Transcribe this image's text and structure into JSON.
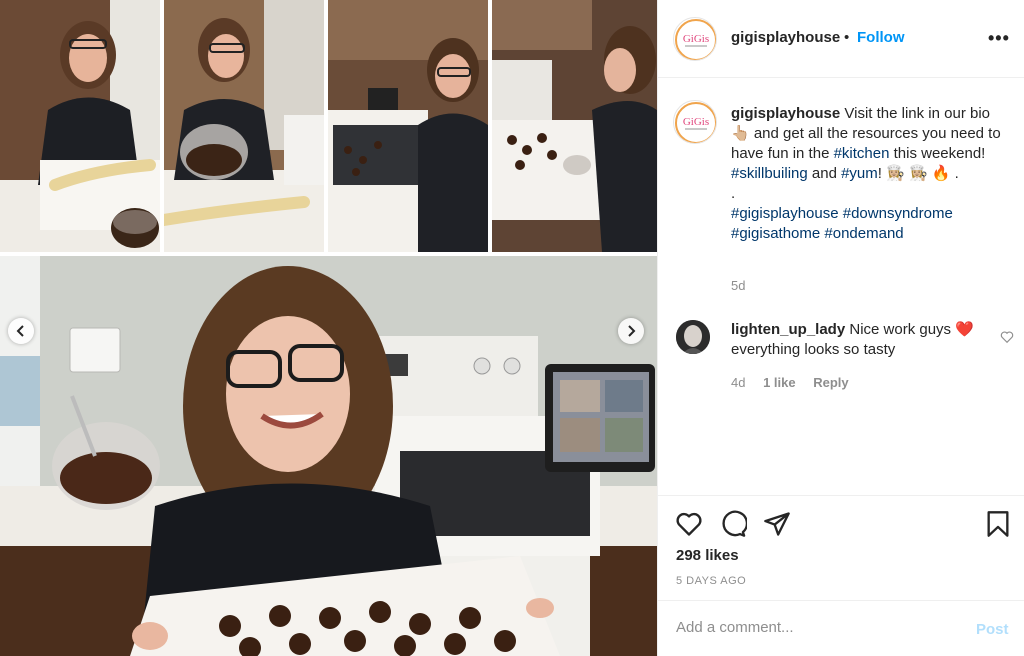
{
  "post": {
    "username": "gigisplayhouse",
    "separator": "•",
    "follow_label": "Follow",
    "more_label": "•••",
    "caption": {
      "part1": "Visit the link in our bio 👆🏼 and get all the resources you need to have fun in the ",
      "tag_kitchen": "#kitchen",
      "part2": " this weekend! ",
      "tag_skill": "#skillbuiling",
      "part3": " and ",
      "tag_yum": "#yum",
      "part4": "! 👩🏼‍🍳 👩🏼‍🍳 🔥 .",
      "dot_line": ".",
      "tag_gigis": "#gigisplayhouse",
      "tag_down": "#downsyndrome",
      "tag_home": "#gigisathome",
      "tag_demand": "#ondemand"
    },
    "time_ago": "5d",
    "comment": {
      "username": "lighten_up_lady",
      "text": "Nice work guys ❤️ everything looks so tasty",
      "time": "4d",
      "likes": "1 like",
      "reply": "Reply"
    },
    "likes_count": "298 likes",
    "date": "5 DAYS AGO",
    "add_comment_placeholder": "Add a comment...",
    "post_label": "Post"
  },
  "colors": {
    "link": "#00376b",
    "follow": "#0095f6",
    "post_disabled": "#b2dffc",
    "muted": "#8e8e8e",
    "heart_red": "#ed4956"
  },
  "icons": {
    "like": "heart-icon",
    "comment": "comment-bubble-icon",
    "share": "paper-plane-icon",
    "save": "bookmark-icon",
    "prev": "chevron-left-icon",
    "next": "chevron-right-icon"
  }
}
